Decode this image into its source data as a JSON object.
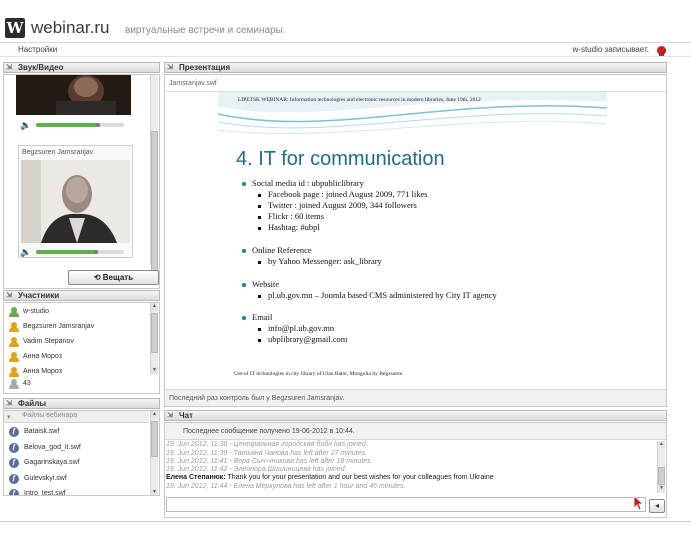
{
  "app": {
    "logo_letter": "W",
    "logo_text": "webinar.ru",
    "tagline": "виртуальные встречи и семинары"
  },
  "menubar": {
    "settings": "Настройки",
    "recording": "w-studio записывает."
  },
  "av_panel": {
    "title": "Звук/Видео",
    "second_name": "Begzsuren Jamsranjav",
    "first_volume": 0.7,
    "second_volume": 0.68,
    "broadcast_button": "Вещать"
  },
  "participants": {
    "title": "Участники",
    "items": [
      {
        "name": "w-studio",
        "color": "#6aa84f"
      },
      {
        "name": "Begzsuren Jamsranjav",
        "color": "#e3a21a"
      },
      {
        "name": "Vadim Stepanov",
        "color": "#e3a21a"
      },
      {
        "name": "Анна Мороз",
        "color": "#e3a21a"
      },
      {
        "name": "Анна Мороз",
        "color": "#e3a21a"
      }
    ],
    "count": "43"
  },
  "files": {
    "title": "Файлы",
    "folder": "Файлы вебинара",
    "items": [
      "Bataisk.swf",
      "Belova_god_it.swf",
      "Gagarinskaya.swf",
      "Gulevskyi.swf",
      "Intro_test.swf"
    ]
  },
  "presentation": {
    "title": "Презентация",
    "filename": "Jamsranjav.swf",
    "control_note": "Последний раз контроль был у Begzsuren Jamsranjav.",
    "slide": {
      "header": "LIPETSK WEBINAR: Information technologies and electronic resources  in  modern libraries,   June 19th, 2012",
      "title": "4. IT for communication",
      "social": "Social media id : ubpubliclibrary",
      "facebook": "Facebook page : joined August 2009,  771 likes",
      "twitter": "Twitter : joined August 2009, 344 followers",
      "flickr": "Flickr : 60 items",
      "hashtag": "Hashtag: #ubpl",
      "online_ref": "Online Reference",
      "yahoo": "by Yahoo Messenger: ask_library",
      "website": "Website",
      "site_url": "pl.ub.gov.mn – Joomla based CMS administered by City IT agency",
      "email": "Email",
      "email1": "info@pl.ub.gov.mn",
      "email2": "ubplibrary@gmail.com",
      "footer": "Use of IT technologies in city library of Ulan Bator, Mongolia by Begzsuren"
    }
  },
  "chat": {
    "title": "Чат",
    "last_message": "Последнее сообщение получено 19-06-2012 в 10:44.",
    "lines": [
      "19. Jun 2012, 11:38 - Центральная городская библ has joined.",
      "19. Jun 2012, 11:39 - Татьяна Чанова has left after 27 minutes.",
      "19. Jun 2012, 11:41 - Вера Сыч-чникова has left after 18 minutes.",
      "19. Jun 2012, 11:42 - Элеонора Шишиницева has joined."
    ],
    "active_sender": "Елена Степанюк:",
    "active_text": "Thank you for your presentation and our best wishes for your colleagues from Ukraine",
    "last_line": "19. Jun 2012, 11:44 - Елена Меркулова has left after 1 hour and 46 minutes."
  }
}
